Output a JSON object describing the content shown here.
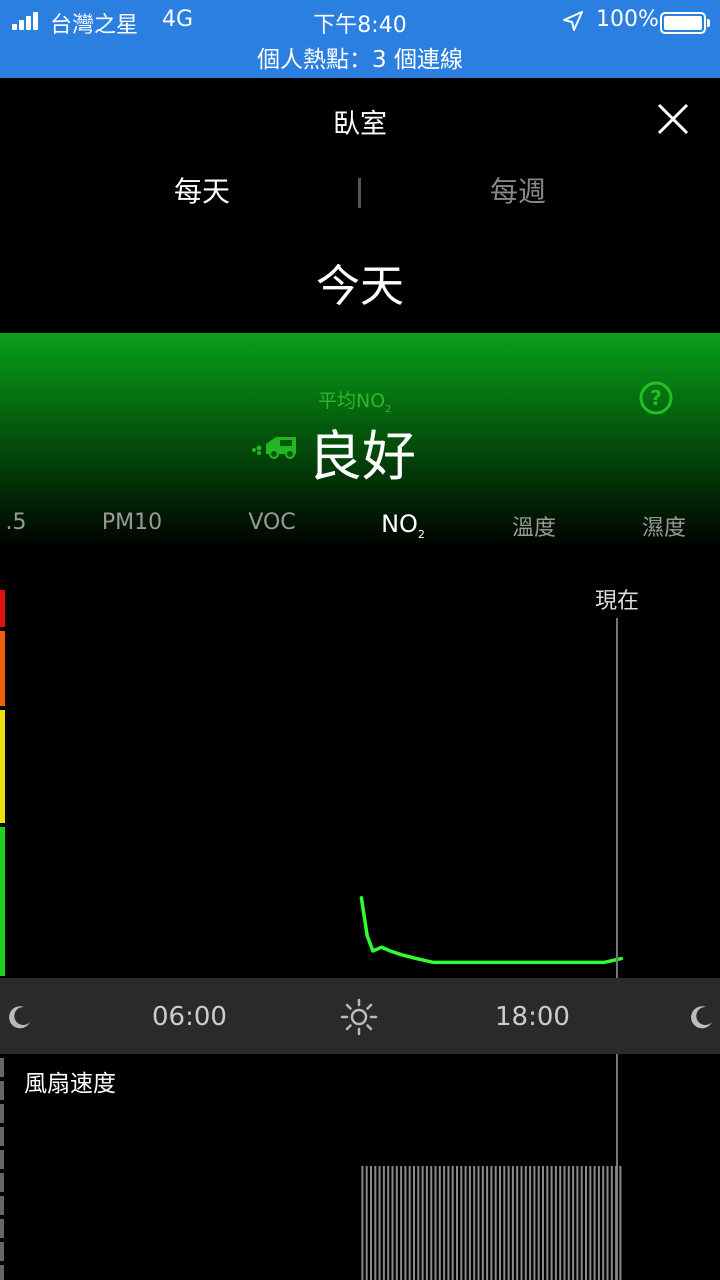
{
  "status_bar": {
    "carrier": "台灣之星",
    "network": "4G",
    "time": "下午8:40",
    "battery": "100%",
    "hotspot": "個人熱點：3 個連線"
  },
  "header": {
    "title": "臥室",
    "close_icon": "close-icon"
  },
  "segments": {
    "daily": "每天",
    "weekly": "每週",
    "selected": "每天"
  },
  "date_label": "今天",
  "summary": {
    "avg_label": "平均NO",
    "avg_sub": "2",
    "status": "良好",
    "status_color": "#1ecf1e",
    "help_icon": "help-circle-icon",
    "car_icon": "car-icon"
  },
  "metric_tabs": {
    "items": [
      {
        "label": ".5",
        "sub": ""
      },
      {
        "label": "PM10",
        "sub": ""
      },
      {
        "label": "VOC",
        "sub": ""
      },
      {
        "label": "NO",
        "sub": "2"
      },
      {
        "label": "溫度",
        "sub": ""
      },
      {
        "label": "濕度",
        "sub": ""
      }
    ],
    "active_index": 3
  },
  "chart": {
    "now_label": "現在",
    "scale_colors": [
      "#e01010",
      "#f06010",
      "#f0e010",
      "#20d020"
    ],
    "line_color": "#30ff30"
  },
  "chart_data": {
    "type": "line",
    "title": "",
    "xlabel": "",
    "ylabel": "",
    "x_ticks": [
      "06:00",
      "18:00"
    ],
    "xlim": [
      0,
      24
    ],
    "ylim": [
      0,
      100
    ],
    "series": [
      {
        "values_x": [
          12.1,
          12.3,
          12.5,
          12.8,
          13.1,
          13.5,
          14.0,
          14.6,
          15.5,
          17,
          19,
          20.5,
          21.1
        ],
        "values_y": [
          19,
          9,
          5,
          6,
          5,
          4,
          3,
          2,
          2,
          2,
          2,
          2,
          3
        ]
      }
    ]
  },
  "time_axis": {
    "labels": [
      "06:00",
      "18:00"
    ],
    "icons": [
      "moon-icon",
      "sun-icon",
      "moon-icon"
    ]
  },
  "fan": {
    "label": "風扇速度",
    "start_hour": 12.1,
    "end_hour": 21.1
  }
}
